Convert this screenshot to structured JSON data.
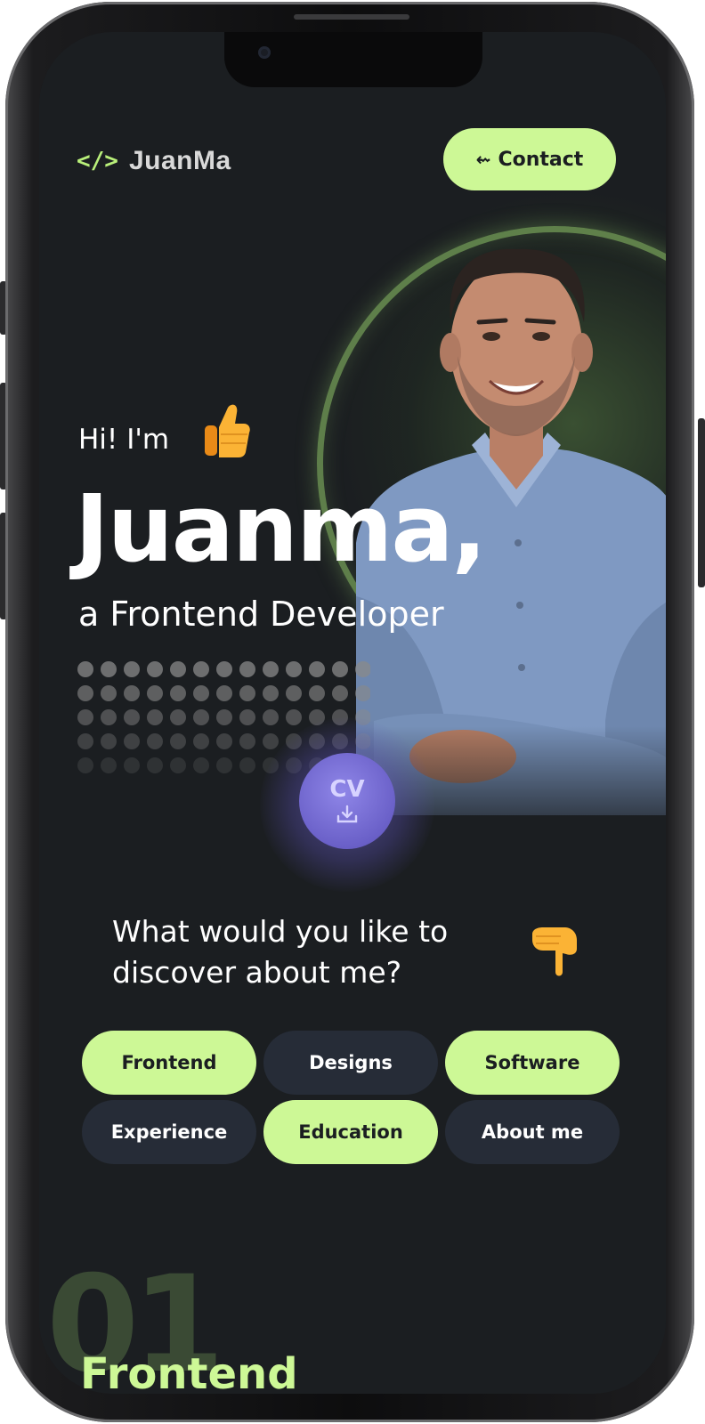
{
  "header": {
    "logo_icon": "</>",
    "logo_text": "JuanMa",
    "contact_arrow": "⇜",
    "contact_label": "Contact"
  },
  "hero": {
    "greeting": "Hi! I'm",
    "greeting_emoji": "thumbs-up-icon",
    "name": "Juanma,",
    "role": "a Frontend Developer"
  },
  "cv_button": {
    "label": "CV",
    "icon": "download-icon"
  },
  "discover": {
    "question_line1": "What would you like to",
    "question_line2": "discover about me?",
    "emoji": "pointing-down-hand-icon"
  },
  "categories": [
    {
      "label": "Frontend",
      "style": "light"
    },
    {
      "label": "Designs",
      "style": "dark"
    },
    {
      "label": "Software",
      "style": "light"
    },
    {
      "label": "Experience",
      "style": "dark"
    },
    {
      "label": "Education",
      "style": "light"
    },
    {
      "label": "About me",
      "style": "dark"
    }
  ],
  "section": {
    "number": "01",
    "title": "Frontend"
  },
  "colors": {
    "accent": "#cdf896",
    "background": "#1b1e21",
    "chip_dark": "#262c37",
    "cv_purple": "#6a60c8"
  }
}
